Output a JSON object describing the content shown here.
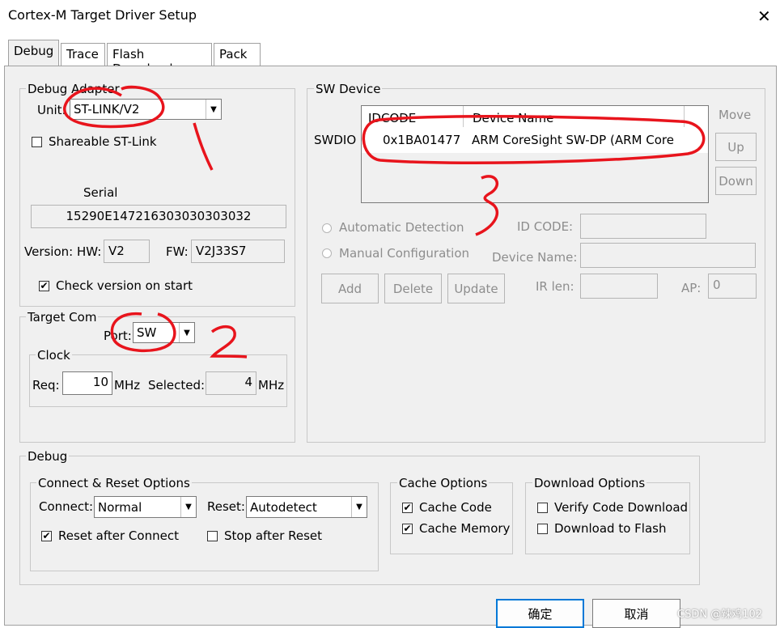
{
  "window": {
    "title": "Cortex-M Target Driver Setup",
    "close_glyph": "✕"
  },
  "tabs": [
    {
      "label": "Debug"
    },
    {
      "label": "Trace"
    },
    {
      "label": "Flash Download"
    },
    {
      "label": "Pack"
    }
  ],
  "debug_adapter": {
    "group_label": "Debug Adapter",
    "unit_label": "Unit:",
    "unit_value": "ST-LINK/V2",
    "shareable_label": "Shareable ST-Link",
    "serial_label": "Serial",
    "serial_value": "15290E147216303030303032",
    "version_label": "Version: HW:",
    "hw_value": "V2",
    "fw_label": "FW:",
    "fw_value": "V2J33S7",
    "check_version_label": "Check version on start",
    "check_mark": "✔"
  },
  "target_com": {
    "group_label": "Target Com",
    "port_label": "Port:",
    "port_value": "SW",
    "clock_label": "Clock",
    "req_label": "Req:",
    "req_value": "10",
    "req_unit": "MHz",
    "selected_label": "Selected:",
    "selected_value": "4",
    "selected_unit": "MHz"
  },
  "sw_device": {
    "group_label": "SW Device",
    "swdio_label": "SWDIO",
    "columns": [
      "IDCODE",
      "Device Name"
    ],
    "rows": [
      {
        "idcode": "0x1BA01477",
        "device_name": "ARM CoreSight SW-DP (ARM Core"
      }
    ],
    "move_label": "Move",
    "up_label": "Up",
    "down_label": "Down",
    "auto_detect_label": "Automatic Detection",
    "manual_config_label": "Manual Configuration",
    "id_code_label": "ID CODE:",
    "device_name_label": "Device Name:",
    "add_label": "Add",
    "delete_label": "Delete",
    "update_label": "Update",
    "ir_len_label": "IR len:",
    "ap_label": "AP:",
    "ap_value": "0"
  },
  "debug_section": {
    "group_label": "Debug",
    "connect_reset_label": "Connect & Reset Options",
    "connect_label": "Connect:",
    "connect_value": "Normal",
    "reset_label": "Reset:",
    "reset_value": "Autodetect",
    "reset_after_connect_label": "Reset after Connect",
    "stop_after_reset_label": "Stop after Reset",
    "cache_options_label": "Cache Options",
    "cache_code_label": "Cache Code",
    "cache_memory_label": "Cache Memory",
    "download_options_label": "Download Options",
    "verify_code_label": "Verify Code Download",
    "download_flash_label": "Download to Flash"
  },
  "footer": {
    "ok_label": "确定",
    "cancel_label": "取消",
    "watermark": "CSDN @辣鸡102"
  },
  "annotations": {
    "mark_2": "2",
    "mark_3": "3",
    "color": "#e8141c"
  }
}
